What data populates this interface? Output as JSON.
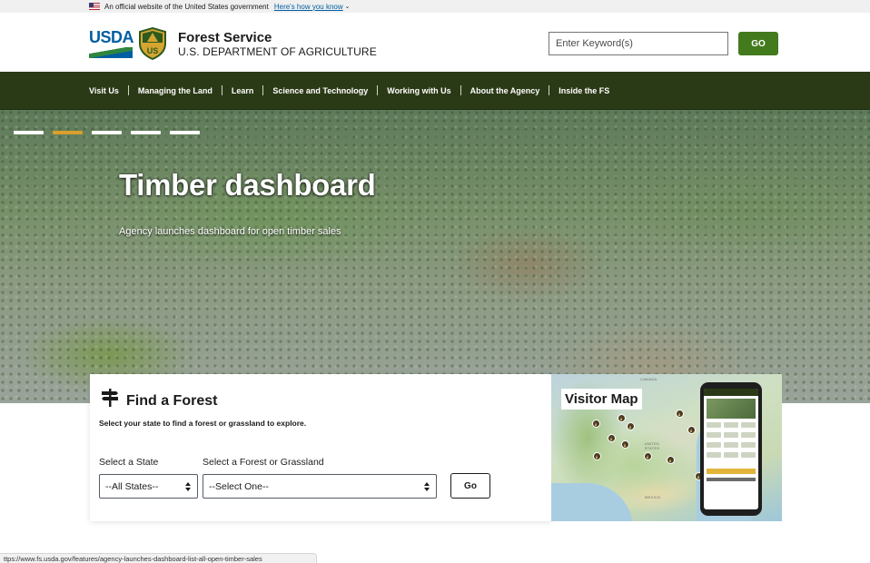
{
  "gov_banner": {
    "text": "An official website of the United States government",
    "link": "Here's how you know",
    "flag_icon": "us-flag-icon",
    "chevron_icon": "chevron-down-icon"
  },
  "header": {
    "usda_logo_text": "USDA",
    "shield_text": "US",
    "agency_name": "Forest Service",
    "department": "U.S. DEPARTMENT OF AGRICULTURE",
    "search_placeholder": "Enter Keyword(s)",
    "search_button": "GO"
  },
  "nav": {
    "items": [
      {
        "label": "Visit Us"
      },
      {
        "label": "Managing the Land"
      },
      {
        "label": "Learn"
      },
      {
        "label": "Science and Technology"
      },
      {
        "label": "Working with Us"
      },
      {
        "label": "About the Agency"
      },
      {
        "label": "Inside the FS"
      }
    ]
  },
  "hero": {
    "title": "Timber dashboard",
    "subtitle": "Agency launches dashboard for open timber sales",
    "slides": 5,
    "active_slide": 2
  },
  "find_forest": {
    "icon": "signpost-icon",
    "title": "Find a Forest",
    "description": "Select your state to find a forest or grassland to explore.",
    "state_label": "Select a State",
    "state_value": "--All States--",
    "forest_label": "Select a Forest or Grassland",
    "forest_value": "--Select One--",
    "go_button": "Go"
  },
  "visitor_map": {
    "title": "Visitor Map",
    "map_label_canada": "CANADA",
    "map_label_us": "UNITED STATES",
    "map_label_mexico": "MEXICO"
  },
  "status_bar": {
    "url": "ttps://www.fs.usda.gov/features/agency-launches-dashboard-list-all-open-timber-sales"
  },
  "colors": {
    "nav_bg": "#2b3a16",
    "go_button_bg": "#437a1d",
    "active_slide": "#d99f2b",
    "usda_blue": "#005ea2"
  }
}
